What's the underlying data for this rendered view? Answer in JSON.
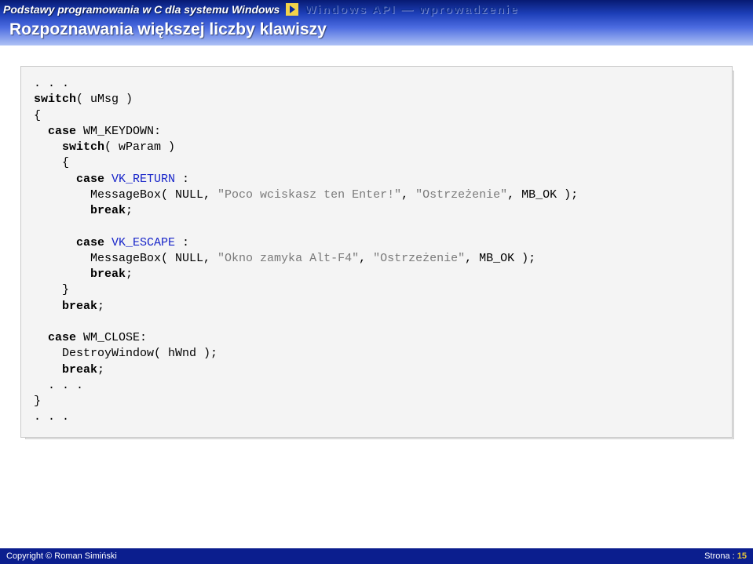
{
  "header": {
    "breadcrumb_left": "Podstawy programowania w C dla systemu Windows",
    "breadcrumb_right": "Windows API — wprowadzenie",
    "title": "Rozpoznawania większej liczby klawiszy"
  },
  "code": {
    "l01": ". . .",
    "l02a": "switch",
    "l02b": "( uMsg )",
    "l03": "{",
    "l04a": "  case",
    "l04b": " WM_KEYDOWN:",
    "l05a": "    switch",
    "l05b": "( wParam )",
    "l06": "    {",
    "l07a": "      case",
    "l07b": " VK_RETURN ",
    "l07c": ":",
    "l08a": "        MessageBox( NULL, ",
    "l08b": "\"Poco wciskasz ten Enter!\"",
    "l08c": ", ",
    "l08d": "\"Ostrzeżenie\"",
    "l08e": ", MB_OK );",
    "l09a": "        break",
    "l09b": ";",
    "l10": "",
    "l11a": "      case",
    "l11b": " VK_ESCAPE ",
    "l11c": ":",
    "l12a": "        MessageBox( NULL, ",
    "l12b": "\"Okno zamyka Alt-F4\"",
    "l12c": ", ",
    "l12d": "\"Ostrzeżenie\"",
    "l12e": ", MB_OK );",
    "l13a": "        break",
    "l13b": ";",
    "l14": "    }",
    "l15a": "    break",
    "l15b": ";",
    "l16": "",
    "l17a": "  case",
    "l17b": " WM_CLOSE:",
    "l18": "    DestroyWindow( hWnd );",
    "l19a": "    break",
    "l19b": ";",
    "l20": "  . . .",
    "l21": "}",
    "l22": ". . ."
  },
  "footer": {
    "copyright": "Copyright © Roman Simiński",
    "page_label": "Strona : ",
    "page_no": "15"
  }
}
